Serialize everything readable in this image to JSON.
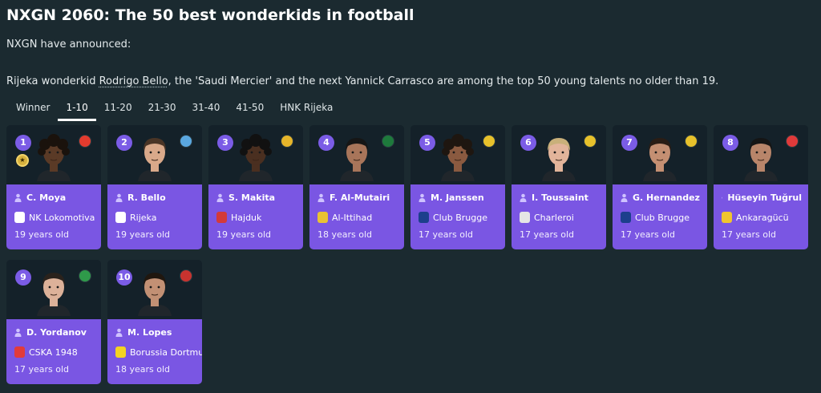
{
  "header": {
    "title": "NXGN 2060: The 50 best wonderkids in football",
    "subtitle": "NXGN have announced:",
    "desc_pre": "Rijeka wonderkid ",
    "desc_link": "Rodrigo Bello",
    "desc_post": ", the 'Saudi Mercier' and the next Yannick Carrasco are among the top 50 young talents no older than 19."
  },
  "tabs": [
    {
      "label": "Winner",
      "active": false
    },
    {
      "label": "1-10",
      "active": true
    },
    {
      "label": "11-20",
      "active": false
    },
    {
      "label": "21-30",
      "active": false
    },
    {
      "label": "31-40",
      "active": false
    },
    {
      "label": "41-50",
      "active": false
    },
    {
      "label": "HNK Rijeka",
      "active": false
    }
  ],
  "cards": [
    {
      "rank": "1",
      "name": "C. Moya",
      "club": "NK Lokomotiva",
      "age": "19 years old",
      "skin": "#5a3a26",
      "hair": "#1a120c",
      "curly": true,
      "flag": "#e23b2e",
      "crest": "#ffffff",
      "tier": true
    },
    {
      "rank": "2",
      "name": "R. Bello",
      "club": "Rijeka",
      "age": "19 years old",
      "skin": "#d9a98a",
      "hair": "#4a3526",
      "curly": false,
      "flag": "#5aa7e0",
      "crest": "#ffffff"
    },
    {
      "rank": "3",
      "name": "S. Makita",
      "club": "Hajduk",
      "age": "19 years old",
      "skin": "#4a2f20",
      "hair": "#111111",
      "curly": true,
      "flag": "#e6b52a",
      "crest": "#d33a3a"
    },
    {
      "rank": "4",
      "name": "F. Al-Mutairi",
      "club": "Al-Ittihad",
      "age": "18 years old",
      "skin": "#a8755a",
      "hair": "#161616",
      "curly": false,
      "flag": "#1e7a3c",
      "crest": "#e8c233"
    },
    {
      "rank": "5",
      "name": "M. Janssen",
      "club": "Club Brugge",
      "age": "17 years old",
      "skin": "#8a5a40",
      "hair": "#1e1610",
      "curly": true,
      "flag": "#e7c12b",
      "crest": "#1c3f8c"
    },
    {
      "rank": "6",
      "name": "I. Toussaint",
      "club": "Charleroi",
      "age": "17 years old",
      "skin": "#e2b49a",
      "hair": "#c9b07a",
      "curly": false,
      "flag": "#e7c12b",
      "crest": "#e5e5e5"
    },
    {
      "rank": "7",
      "name": "G. Hernandez",
      "club": "Club Brugge",
      "age": "17 years old",
      "skin": "#c48f72",
      "hair": "#2a1d15",
      "curly": false,
      "flag": "#e7c12b",
      "crest": "#1c3f8c"
    },
    {
      "rank": "8",
      "name": "Hüseyin Tuğrul",
      "club": "Ankaragücü",
      "age": "17 years old",
      "skin": "#b8856a",
      "hair": "#151515",
      "curly": false,
      "flag": "#e03a3a",
      "crest": "#f0c52e"
    },
    {
      "rank": "9",
      "name": "D. Yordanov",
      "club": "CSKA 1948",
      "age": "17 years old",
      "skin": "#dcb199",
      "hair": "#2a221c",
      "curly": false,
      "flag": "#2f9a4a",
      "crest": "#e23b3b"
    },
    {
      "rank": "10",
      "name": "M. Lopes",
      "club": "Borussia Dortmund",
      "age": "18 years old",
      "skin": "#c29074",
      "hair": "#20170f",
      "curly": false,
      "flag": "#c8332f",
      "crest": "#f4d322"
    }
  ]
}
